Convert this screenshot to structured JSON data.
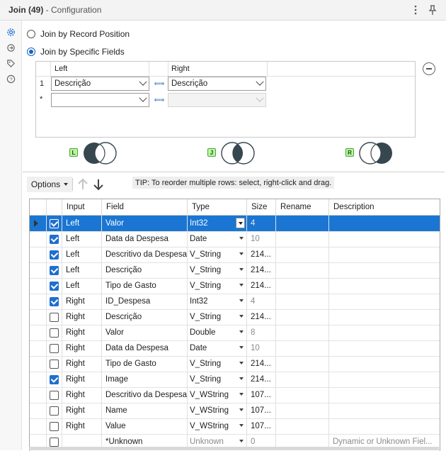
{
  "header": {
    "title_bold": "Join (49)",
    "title_rest": " - Configuration"
  },
  "rail": {
    "icons": [
      "gear-icon",
      "cycle-icon",
      "tag-icon",
      "help-icon"
    ]
  },
  "join_mode": {
    "options": [
      {
        "label": "Join by Record Position",
        "selected": false
      },
      {
        "label": "Join by Specific Fields",
        "selected": true
      }
    ]
  },
  "join_fields": {
    "left_header": "Left",
    "right_header": "Right",
    "rows": [
      {
        "num": "1",
        "left": "Descrição",
        "right": "Descrição"
      },
      {
        "num": "*",
        "left": "",
        "right": ""
      }
    ]
  },
  "venn": [
    {
      "tag": "L",
      "name": "left"
    },
    {
      "tag": "J",
      "name": "join"
    },
    {
      "tag": "R",
      "name": "right"
    }
  ],
  "toolbar": {
    "options_label": "Options",
    "tip": "TIP: To reorder multiple rows: select, right-click and drag."
  },
  "table": {
    "columns": [
      "Input",
      "Field",
      "Type",
      "Size",
      "Rename",
      "Description"
    ],
    "rows": [
      {
        "checked": true,
        "input": "Left",
        "field": "Valor",
        "type": "Int32",
        "size": "4",
        "size_grey": true,
        "rename": "",
        "description": ""
      },
      {
        "checked": true,
        "input": "Left",
        "field": "Data da Despesa",
        "type": "Date",
        "size": "10",
        "size_grey": true,
        "rename": "",
        "description": ""
      },
      {
        "checked": true,
        "input": "Left",
        "field": "Descritivo da Despesa",
        "type": "V_String",
        "size": "214...",
        "size_grey": false,
        "rename": "",
        "description": ""
      },
      {
        "checked": true,
        "input": "Left",
        "field": "Descrição",
        "type": "V_String",
        "size": "214...",
        "size_grey": false,
        "rename": "",
        "description": ""
      },
      {
        "checked": true,
        "input": "Left",
        "field": "Tipo de Gasto",
        "type": "V_String",
        "size": "214...",
        "size_grey": false,
        "rename": "",
        "description": ""
      },
      {
        "checked": true,
        "input": "Right",
        "field": "ID_Despesa",
        "type": "Int32",
        "size": "4",
        "size_grey": true,
        "rename": "",
        "description": ""
      },
      {
        "checked": false,
        "input": "Right",
        "field": "Descrição",
        "type": "V_String",
        "size": "214...",
        "size_grey": false,
        "rename": "",
        "description": ""
      },
      {
        "checked": false,
        "input": "Right",
        "field": "Valor",
        "type": "Double",
        "size": "8",
        "size_grey": true,
        "rename": "",
        "description": ""
      },
      {
        "checked": false,
        "input": "Right",
        "field": "Data da Despesa",
        "type": "Date",
        "size": "10",
        "size_grey": true,
        "rename": "",
        "description": ""
      },
      {
        "checked": false,
        "input": "Right",
        "field": "Tipo de Gasto",
        "type": "V_String",
        "size": "214...",
        "size_grey": false,
        "rename": "",
        "description": ""
      },
      {
        "checked": true,
        "input": "Right",
        "field": "Image",
        "type": "V_String",
        "size": "214...",
        "size_grey": false,
        "rename": "",
        "description": ""
      },
      {
        "checked": false,
        "input": "Right",
        "field": "Descritivo da Despesa",
        "type": "V_WString",
        "size": "107...",
        "size_grey": false,
        "rename": "",
        "description": ""
      },
      {
        "checked": false,
        "input": "Right",
        "field": "Name",
        "type": "V_WString",
        "size": "107...",
        "size_grey": false,
        "rename": "",
        "description": ""
      },
      {
        "checked": false,
        "input": "Right",
        "field": "Value",
        "type": "V_WString",
        "size": "107...",
        "size_grey": false,
        "rename": "",
        "description": ""
      },
      {
        "checked": false,
        "input": "",
        "field": "*Unknown",
        "type": "Unknown",
        "size": "0",
        "size_grey": true,
        "rename": "",
        "description": "Dynamic or Unknown Fiel...",
        "type_grey": true,
        "desc_grey": true
      }
    ]
  },
  "colors": {
    "selection": "#1a76d2",
    "accent": "#1565c0",
    "venn_dark": "#37474f",
    "tag_green": "#b7f5a0"
  }
}
